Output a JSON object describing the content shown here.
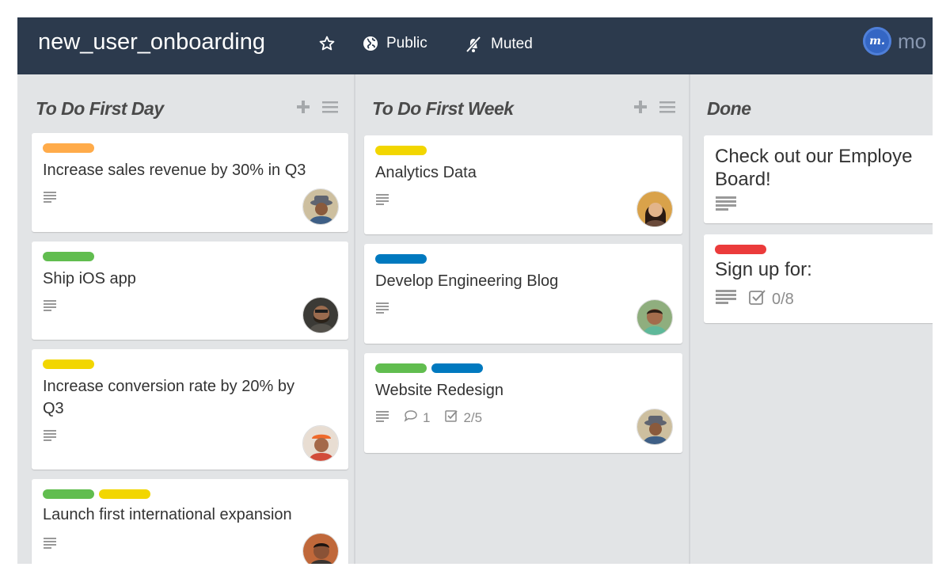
{
  "board": {
    "title": "new_user_onboarding",
    "public_label": "Public",
    "muted_label": "Muted",
    "logo_text": "mo",
    "logo_mark": "m."
  },
  "colors": {
    "header_bg": "#2c3a4d",
    "board_bg": "#e2e4e6",
    "label_orange": "#ffab4a",
    "label_green": "#61bd4f",
    "label_yellow": "#f2d600",
    "label_blue": "#0079bf",
    "label_red": "#eb5a46"
  },
  "lists": [
    {
      "title": "To Do First Day",
      "cards": [
        {
          "title": "Increase sales revenue by 30% in Q3",
          "labels": [
            "orange"
          ],
          "avatar": "man-gray-hat"
        },
        {
          "title": "Ship iOS app",
          "labels": [
            "green"
          ],
          "avatar": "man-beard-dark"
        },
        {
          "title_line1": "Increase conversion rate by 20% by",
          "title_line2": "Q3",
          "labels": [
            "yellow"
          ],
          "avatar": "man-orange-cap"
        },
        {
          "title": "Launch first international expansion",
          "labels": [
            "green",
            "yellow"
          ],
          "avatar": "man-smiling"
        }
      ]
    },
    {
      "title": "To Do First Week",
      "cards": [
        {
          "title": "Analytics Data",
          "labels": [
            "yellow"
          ],
          "avatar": "woman-smiling"
        },
        {
          "title": "Develop Engineering Blog",
          "labels": [
            "blue"
          ],
          "avatar": "man-outdoor"
        },
        {
          "title": "Website Redesign",
          "labels": [
            "green",
            "blue"
          ],
          "comments": "1",
          "checklist": "2/5",
          "avatar": "man-gray-hat"
        }
      ]
    },
    {
      "title": "Done",
      "cards": [
        {
          "title_line1": "Check out our Employe",
          "title_line2": "Board!"
        },
        {
          "title": "Sign up for:",
          "labels": [
            "red"
          ],
          "checklist": "0/8"
        }
      ]
    }
  ]
}
